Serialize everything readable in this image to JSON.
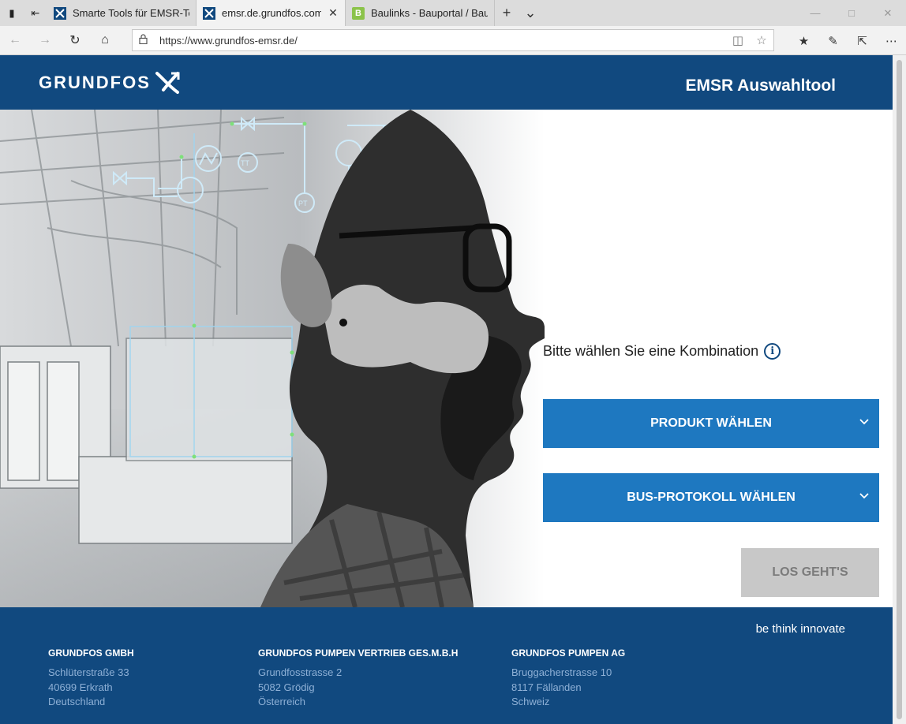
{
  "browser": {
    "tabs": [
      {
        "label": "Smarte Tools für EMSR-Tech",
        "favicon": "grundfos-favicon",
        "active": false
      },
      {
        "label": "emsr.de.grundfos.com",
        "favicon": "grundfos-favicon",
        "active": true
      },
      {
        "label": "Baulinks - Bauportal / Baum",
        "favicon": "baulinks-favicon",
        "active": false
      }
    ],
    "favicon_letter_baulinks": "B",
    "url": "https://www.grundfos-emsr.de/"
  },
  "header": {
    "logo_text": "GRUNDFOS",
    "app_title": "EMSR Auswahltool"
  },
  "main": {
    "prompt": "Bitte wählen Sie eine Kombination",
    "info_icon_glyph": "i",
    "select_product": "PRODUKT WÄHLEN",
    "select_protocol": "BUS-PROTOKOLL WÄHLEN",
    "go_button": "LOS GEHT'S"
  },
  "footer": {
    "slogan": "be think innovate",
    "companies": [
      {
        "name": "GRUNDFOS GMBH",
        "lines": [
          "Schlüterstraße 33",
          "40699 Erkrath",
          "Deutschland"
        ]
      },
      {
        "name": "GRUNDFOS PUMPEN VERTRIEB GES.M.B.H",
        "lines": [
          "Grundfosstrasse 2",
          "5082 Grödig",
          "Österreich"
        ]
      },
      {
        "name": "GRUNDFOS PUMPEN AG",
        "lines": [
          "Bruggacherstrasse 10",
          "8117 Fällanden",
          "Schweiz"
        ]
      }
    ]
  },
  "hero_labels": {
    "pt": "PT",
    "tt": "TT"
  },
  "colors": {
    "brand_blue": "#11497f",
    "button_blue": "#1e78c0",
    "disabled_grey": "#c8c8c8"
  }
}
